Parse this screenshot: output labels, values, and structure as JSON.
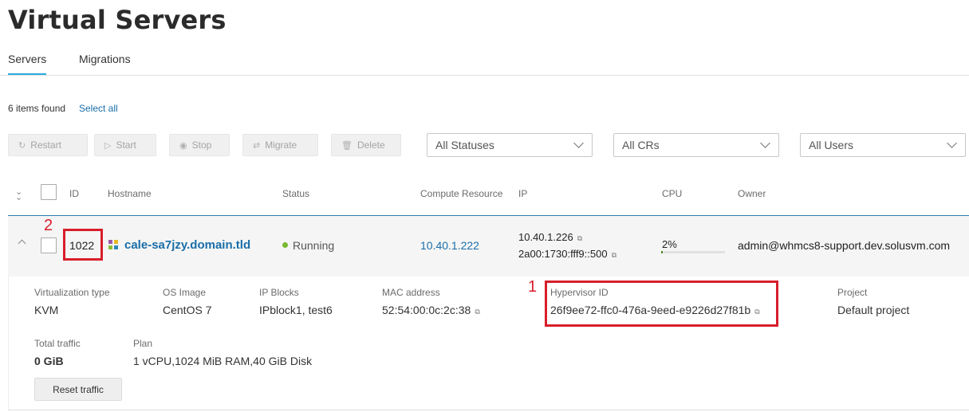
{
  "page": {
    "title": "Virtual Servers"
  },
  "tabs": [
    {
      "label": "Servers",
      "active": true
    },
    {
      "label": "Migrations",
      "active": false
    }
  ],
  "summary": {
    "items_found": "6 items found",
    "select_all": "Select all"
  },
  "toolbar": {
    "restart": "Restart",
    "start": "Start",
    "stop": "Stop",
    "migrate": "Migrate",
    "delete": "Delete"
  },
  "filters": {
    "status": "All Statuses",
    "compute_resource": "All CRs",
    "users": "All Users"
  },
  "table": {
    "headers": {
      "id": "ID",
      "hostname": "Hostname",
      "status": "Status",
      "compute_resource": "Compute Resource",
      "ip": "IP",
      "cpu": "CPU",
      "owner": "Owner"
    },
    "row": {
      "id": "1022",
      "hostname": "cale-sa7jzy.domain.tld",
      "status": "Running",
      "compute_resource": "10.40.1.222",
      "ipv4": "10.40.1.226",
      "ipv6": "2a00:1730:fff9::500",
      "cpu": "2%",
      "cpu_fraction": 0.02,
      "owner": "admin@whmcs8-support.dev.solusvm.com"
    }
  },
  "details": {
    "virtualization_type_label": "Virtualization type",
    "virtualization_type": "KVM",
    "os_image_label": "OS Image",
    "os_image": "CentOS 7",
    "ip_blocks_label": "IP Blocks",
    "ip_blocks": "IPblock1, test6",
    "mac_label": "MAC address",
    "mac": "52:54:00:0c:2c:38",
    "hypervisor_id_label": "Hypervisor ID",
    "hypervisor_id": "26f9ee72-ffc0-476a-9eed-e9226d27f81b",
    "project_label": "Project",
    "project": "Default project",
    "total_traffic_label": "Total traffic",
    "total_traffic": "0 GiB",
    "plan_label": "Plan",
    "plan": "1 vCPU,1024 MiB RAM,40 GiB Disk",
    "reset_traffic": "Reset traffic"
  },
  "annotations": {
    "marker_1": "1",
    "marker_2": "2"
  },
  "colors": {
    "accent": "#1a6ea8",
    "tab_underline": "#28aade",
    "running": "#7ab82f",
    "annotation": "#d81e2b"
  },
  "icons": [
    "restart-icon",
    "play-icon",
    "stop-icon",
    "migrate-icon",
    "trash-icon",
    "chevron-down-icon",
    "copy-icon",
    "os-logo-icon"
  ]
}
